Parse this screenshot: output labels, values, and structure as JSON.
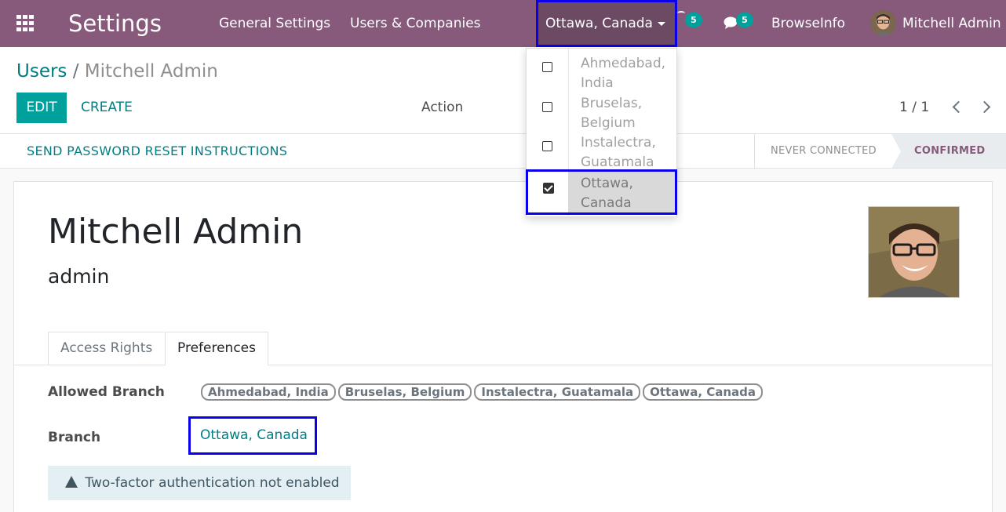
{
  "navbar": {
    "app_title": "Settings",
    "menu": [
      "General Settings",
      "Users & Companies"
    ],
    "branch_switcher": "Ottawa, Canada",
    "activity_count": "5",
    "messages_count": "5",
    "company": "BrowseInfo",
    "user": "Mitchell Admin"
  },
  "breadcrumb": {
    "parent": "Users",
    "separator": "/",
    "current": "Mitchell Admin"
  },
  "toolbar": {
    "edit_label": "EDIT",
    "create_label": "CREATE",
    "action_label": "Action",
    "pager": "1 / 1"
  },
  "statusbar": {
    "reset_label": "SEND PASSWORD RESET INSTRUCTIONS",
    "stages": [
      "NEVER CONNECTED",
      "CONFIRMED"
    ],
    "active_stage": "CONFIRMED"
  },
  "form": {
    "name": "Mitchell Admin",
    "login": "admin",
    "tabs": [
      "Access Rights",
      "Preferences"
    ],
    "active_tab": "Preferences",
    "allowed_branch_label": "Allowed Branch",
    "allowed_branches": [
      "Ahmedabad, India",
      "Bruselas, Belgium",
      "Instalectra, Guatamala",
      "Ottawa, Canada"
    ],
    "branch_label": "Branch",
    "branch_value": "Ottawa, Canada",
    "alert_2fa": "Two-factor authentication not enabled"
  },
  "dropdown": {
    "items": [
      {
        "label": "Ahmedabad, India",
        "checked": false
      },
      {
        "label": "Bruselas, Belgium",
        "checked": false
      },
      {
        "label": "Instalectra, Guatamala",
        "checked": false
      },
      {
        "label": "Ottawa, Canada",
        "checked": true
      }
    ]
  },
  "colors": {
    "navbar": "#875a7b",
    "accent": "#00a09d",
    "link": "#017e84",
    "highlight_border": "#0b00ea"
  }
}
